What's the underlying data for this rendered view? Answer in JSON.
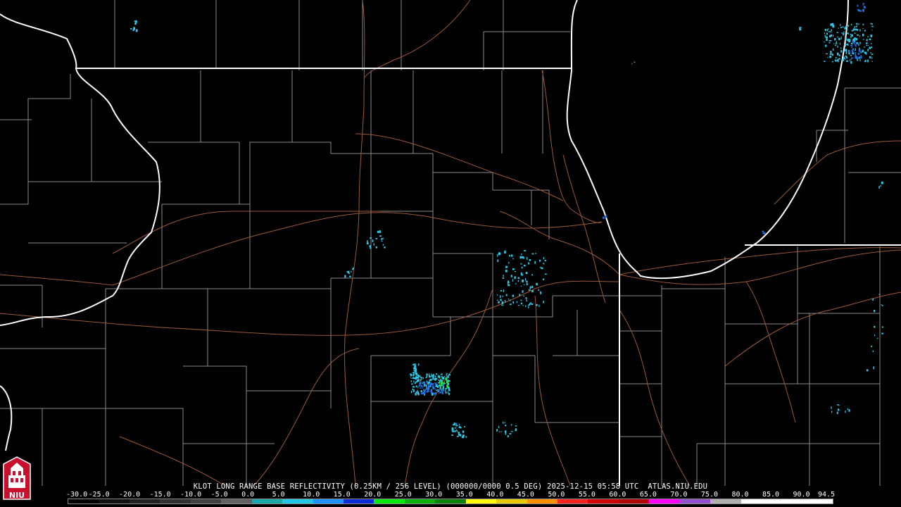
{
  "header": {
    "caption": "KLOT LONG RANGE BASE REFLECTIVITY (0.25KM / 256 LEVEL) (000000/0000 0.5 DEG) 2025-12-15 05:58 UTC  ATLAS.NIU.EDU"
  },
  "logo": {
    "text": "NIU",
    "color": "#c8102e"
  },
  "legend": {
    "values": [
      "-30.0",
      "-25.0",
      "-20.0",
      "-15.0",
      "-10.0",
      "-5.0",
      "0.0",
      "5.0",
      "10.0",
      "15.0",
      "20.0",
      "25.0",
      "30.0",
      "35.0",
      "40.0",
      "45.0",
      "50.0",
      "55.0",
      "60.0",
      "65.0",
      "70.0",
      "75.0",
      "80.0",
      "85.0",
      "90.0",
      "94.5"
    ],
    "colors": [
      "#000000",
      "#101010",
      "#202020",
      "#303030",
      "#404040",
      "#606060",
      "#1aa6a6",
      "#21c8e6",
      "#1e90ff",
      "#0b2bd6",
      "#08e808",
      "#06b006",
      "#068006",
      "#ffff00",
      "#e8c800",
      "#ff9000",
      "#ff2020",
      "#d00000",
      "#b00000",
      "#ff00ff",
      "#9050d0",
      "#b0b0b0",
      "#ffffff",
      "#ffffff",
      "#ffffff"
    ]
  },
  "map": {
    "colors": {
      "state_border": "#ffffff",
      "county_border": "#8a8a8a",
      "highway": "#9a5a3a",
      "echo_light": "#2ec8e6",
      "echo_medium": "#1e6fe0",
      "echo_strong": "#2ee04a"
    }
  }
}
